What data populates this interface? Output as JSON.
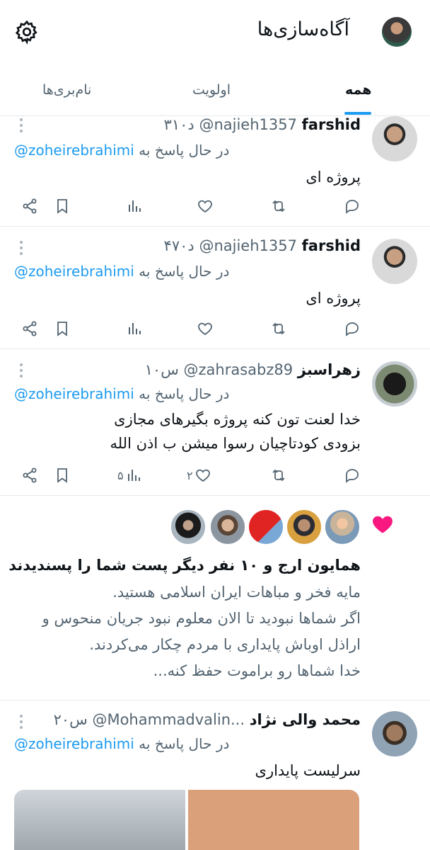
{
  "header": {
    "title": "آگاه‌سازی‌ها",
    "tabs": [
      "همه",
      "اولویت",
      "نام‌بری‌ها"
    ]
  },
  "accent_color": "#1d9bf0",
  "like_color": "#f91880",
  "tweets": [
    {
      "name": "farshid",
      "handle": "@najieh1357",
      "time": "۳۱۰د",
      "reply_prefix": "در حال پاسخ به",
      "reply_to": "@zoheirebrahimi",
      "text": "پروژه ای"
    },
    {
      "name": "farshid",
      "handle": "@najieh1357",
      "time": "۴۷۰د",
      "reply_prefix": "در حال پاسخ به",
      "reply_to": "@zoheirebrahimi",
      "text": "پروژه ای"
    },
    {
      "name": "زهراسبز",
      "handle": "@zahrasabz89",
      "time": "۱۰س",
      "reply_prefix": "در حال پاسخ به",
      "reply_to": "@zoheirebrahimi",
      "text_lines": [
        "خدا لعنت تون کنه پروژه بگیرهای مجازی",
        "بزودی کودتاچیان رسوا میشن ب اذن الله"
      ],
      "views": "۵",
      "likes": "۲"
    },
    {
      "name": "محمد والی نژاد",
      "handle": "@Mohammadvalin...",
      "time": "۲۰س",
      "reply_prefix": "در حال پاسخ به",
      "reply_to": "@zoheirebrahimi",
      "text": "سرلیست پایداری"
    }
  ],
  "like_notification": {
    "headline": "همایون ارج و ۱۰ نفر دیگر پست شما را پسندیدند",
    "lines": [
      "مایه فخر و مباهات ایران اسلامی هستید.",
      "اگر شماها نبودید تا الان معلوم نبود جریان منحوس و",
      "اراذل اوباش پایداری با مردم چکار می‌کردند.",
      "خدا شماها رو براموت حفظ کنه..."
    ]
  },
  "icons": [
    "gear-icon",
    "more-icon",
    "reply-icon",
    "retweet-icon",
    "like-icon",
    "views-icon",
    "bookmark-icon",
    "share-icon",
    "heart-icon"
  ]
}
